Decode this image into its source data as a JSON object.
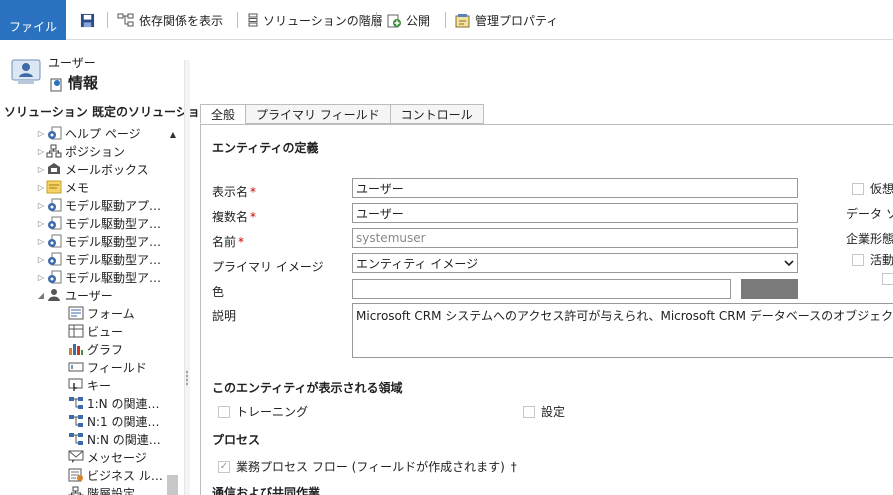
{
  "ribbon": {
    "file": "ファイル",
    "show_dependencies": "依存関係を表示",
    "solution_layers": "ソリューションの階層",
    "publish": "公開",
    "managed_properties": "管理プロパティ"
  },
  "entity": {
    "type_label": "ユーザー",
    "title": "情報"
  },
  "solution": {
    "label": "ソリューション 既定のソリューション"
  },
  "tree": [
    {
      "label": "ヘルプ ページ",
      "icon": "gear-doc-icon",
      "arrow": "▷"
    },
    {
      "label": "ポジション",
      "icon": "hierarchy-icon",
      "arrow": "▷"
    },
    {
      "label": "メールボックス",
      "icon": "mailbox-icon",
      "arrow": "▷"
    },
    {
      "label": "メモ",
      "icon": "note-icon",
      "arrow": "▷"
    },
    {
      "label": "モデル駆動アプリ…",
      "icon": "gear-doc-icon",
      "arrow": "▷"
    },
    {
      "label": "モデル駆動型アプ…",
      "icon": "gear-doc-icon",
      "arrow": "▷"
    },
    {
      "label": "モデル駆動型アプ…",
      "icon": "gear-doc-icon",
      "arrow": "▷"
    },
    {
      "label": "モデル駆動型アプ…",
      "icon": "gear-doc-icon",
      "arrow": "▷"
    },
    {
      "label": "モデル駆動型アプ…",
      "icon": "gear-doc-icon",
      "arrow": "▷"
    },
    {
      "label": "ユーザー",
      "icon": "user-icon",
      "arrow": "◢"
    }
  ],
  "subtree": [
    {
      "label": "フォーム",
      "icon": "form-icon"
    },
    {
      "label": "ビュー",
      "icon": "view-icon"
    },
    {
      "label": "グラフ",
      "icon": "chart-icon"
    },
    {
      "label": "フィールド",
      "icon": "field-icon"
    },
    {
      "label": "キー",
      "icon": "key-icon"
    },
    {
      "label": "1:N の関連…",
      "icon": "relation-icon"
    },
    {
      "label": "N:1 の関連…",
      "icon": "relation-icon"
    },
    {
      "label": "N:N の関連…",
      "icon": "relation-icon"
    },
    {
      "label": "メッセージ",
      "icon": "message-icon"
    },
    {
      "label": "ビジネス ルール",
      "icon": "rule-icon"
    },
    {
      "label": "階層設定",
      "icon": "hierarchy-icon"
    }
  ],
  "tabs": [
    "全般",
    "プライマリ フィールド",
    "コントロール"
  ],
  "form": {
    "section_definition": "エンティティの定義",
    "display_name_label": "表示名",
    "display_name_value": "ユーザー",
    "plural_name_label": "複数名",
    "plural_name_value": "ユーザー",
    "name_label": "名前",
    "name_value": "systemuser",
    "primary_image_label": "プライマリ イメージ",
    "primary_image_value": "エンティティ イメージ",
    "color_label": "色",
    "description_label": "説明",
    "description_value": "Microsoft CRM システムへのアクセス許可が与えられ、Microsoft CRM データベースのオブジェクトを所有している",
    "required_mark": "*",
    "section_areas": "このエンティティが表示される領域",
    "training_label": "トレーニング",
    "settings_label": "設定",
    "section_process": "プロセス",
    "bpf_label": "業務プロセス フロー (フィールドが作成されます)",
    "bpf_mark": "†",
    "section_comm": "通信および共同作業",
    "right_virtual": "仮想",
    "right_datasource": "データ ソー",
    "right_ownership": "企業形態",
    "right_activity": "活動"
  }
}
